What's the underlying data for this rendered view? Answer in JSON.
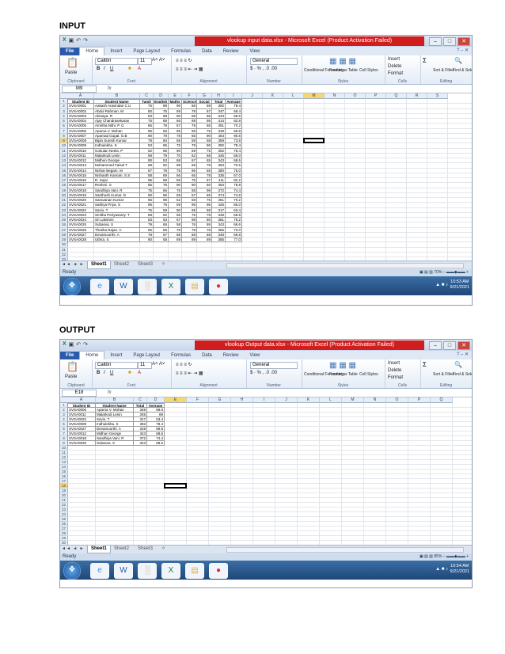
{
  "input_section": {
    "heading": "INPUT",
    "window_title": "vlookup input data.xlsx - Microsoft Excel (Product Activation Failed)",
    "name_box": "M9",
    "formula_fx": "fx",
    "columns": [
      "A",
      "B",
      "C",
      "D",
      "E",
      "F",
      "G",
      "H",
      "I",
      "J",
      "K",
      "L",
      "M",
      "N",
      "O",
      "P",
      "Q",
      "R",
      "S"
    ],
    "table_headers": [
      "Student ID",
      "Student Name",
      "Tamil",
      "English",
      "Maths",
      "Science",
      "Social",
      "Total",
      "Average"
    ],
    "rows": [
      [
        "SVSA0001",
        "Aakash Aravindan C.U",
        "76",
        "89",
        "90",
        "58",
        "69",
        "392",
        "78.4"
      ],
      [
        "SVSA0002",
        "Abdul Rahman. M",
        "80",
        "75",
        "59",
        "78",
        "67",
        "347",
        "69.4"
      ],
      [
        "SVSA0003",
        "Abinaya. R",
        "83",
        "68",
        "60",
        "68",
        "56",
        "343",
        "68.6"
      ],
      [
        "SVSA0004",
        "Ajay Chandrasekaran",
        "75",
        "89",
        "66",
        "89",
        "95",
        "414",
        "82.8"
      ],
      [
        "SVSA0005",
        "Amritha Nithi. P. G",
        "66",
        "79",
        "67",
        "75",
        "65",
        "351",
        "70.2"
      ],
      [
        "SVSA0006",
        "Aparna V. Mohan",
        "85",
        "65",
        "56",
        "69",
        "75",
        "349",
        "69.8"
      ],
      [
        "SVSA0007",
        "Aparnad Gopal. G.B",
        "90",
        "79",
        "78",
        "65",
        "90",
        "454",
        "90.8"
      ],
      [
        "SVSA0008",
        "Bipin Suresh Kumar",
        "78",
        "60",
        "65",
        "59",
        "58",
        "359",
        "73.8"
      ],
      [
        "SVSA0009",
        "Indhulekha. S",
        "53",
        "65",
        "75",
        "79",
        "90",
        "392",
        "78.4"
      ],
      [
        "SVSA0010",
        "Gokulan Neela. P",
        "62",
        "96",
        "90",
        "59",
        "75",
        "392",
        "78.4"
      ],
      [
        "SVSA0011",
        "Malarkodi Lenin",
        "59",
        "79",
        "70",
        "62",
        "68",
        "345",
        "69.0"
      ],
      [
        "SVSA0012",
        "Midhun George",
        "90",
        "53",
        "68",
        "67",
        "65",
        "343",
        "68.6"
      ],
      [
        "SVSA0013",
        "Mohammed Faisal T",
        "68",
        "82",
        "89",
        "58",
        "78",
        "353",
        "70.6"
      ],
      [
        "SVSA0014",
        "Nishar Begam. M",
        "67",
        "78",
        "75",
        "95",
        "65",
        "380",
        "76.0"
      ],
      [
        "SVSA0015",
        "Nishanth Kannan. S.S",
        "58",
        "69",
        "66",
        "65",
        "78",
        "335",
        "67.0"
      ],
      [
        "SVSA0016",
        "R. Sujai",
        "95",
        "89",
        "85",
        "75",
        "67",
        "411",
        "82.2"
      ],
      [
        "SVSA0017",
        "Reshmi. S",
        "65",
        "75",
        "90",
        "90",
        "50",
        "394",
        "78.8"
      ],
      [
        "SVSA0018",
        "Sandhiya Vani. R",
        "75",
        "66",
        "76",
        "58",
        "96",
        "372",
        "74.4"
      ],
      [
        "SVSA0019",
        "Santhosh Kumar. D",
        "90",
        "85",
        "59",
        "67",
        "65",
        "374",
        "74.8"
      ],
      [
        "SVSA0020",
        "Saravanan Kumar",
        "56",
        "98",
        "62",
        "58",
        "75",
        "351",
        "70.2"
      ],
      [
        "SVSA0021",
        "Sathiya Priya. S",
        "95",
        "78",
        "59",
        "95",
        "96",
        "425",
        "85.0"
      ],
      [
        "SVSA0022",
        "Savio. T",
        "75",
        "59",
        "90",
        "65",
        "58",
        "317",
        "63.4"
      ],
      [
        "SVSA0023",
        "Smitha Periyasamy. T",
        "68",
        "62",
        "66",
        "75",
        "78",
        "349",
        "69.8"
      ],
      [
        "SVSA0024",
        "Sri Lakshmi",
        "83",
        "53",
        "67",
        "98",
        "60",
        "381",
        "76.2"
      ],
      [
        "SVSA0025",
        "Subasva. S",
        "79",
        "65",
        "58",
        "76",
        "65",
        "343",
        "68.6"
      ],
      [
        "SVSA0026",
        "Tharika Rajan. C",
        "65",
        "66",
        "78",
        "78",
        "78",
        "365",
        "73.0"
      ],
      [
        "SVSA0027",
        "Devamoorthi. A",
        "78",
        "67",
        "68",
        "68",
        "68",
        "349",
        "69.8"
      ],
      [
        "SVSA0028",
        "Uthira. S",
        "80",
        "58",
        "89",
        "89",
        "89",
        "385",
        "77.0"
      ]
    ],
    "sheet_tabs": [
      "Sheet1",
      "Sheet2",
      "Sheet3"
    ],
    "status": "Ready",
    "zoom": "70%",
    "clock_time": "10:53 AM",
    "clock_date": "9/21/2021"
  },
  "output_section": {
    "heading": "OUTPUT",
    "window_title": "vlookup Output data.xlsx - Microsoft Excel (Product Activation Failed)",
    "name_box": "E18",
    "formula_fx": "fx",
    "columns": [
      "A",
      "B",
      "C",
      "D",
      "E",
      "F",
      "G",
      "H",
      "I",
      "J",
      "K",
      "L",
      "M",
      "N",
      "O",
      "P",
      "Q"
    ],
    "table_headers": [
      "Student ID",
      "Student Name",
      "Total",
      "Average"
    ],
    "rows": [
      [
        "SVSA0006",
        "Aparna V. Mohan",
        "349",
        "69.8"
      ],
      [
        "SVSA0011",
        "Malarkodi Lenin",
        "345",
        "69"
      ],
      [
        "SVSA0022",
        "Savio. T",
        "317",
        "63.4"
      ],
      [
        "SVSA0009",
        "Indhulekha. S",
        "392",
        "78.4"
      ],
      [
        "SVSA0027",
        "Devamoorthi. A",
        "349",
        "69.8"
      ],
      [
        "SVSA0012",
        "Midhun George",
        "343",
        "68.6"
      ],
      [
        "SVSA0018",
        "Sandhiya Vani. R",
        "372",
        "74.4"
      ],
      [
        "SVSA0025",
        "Subasva. S",
        "343",
        "68.6"
      ]
    ],
    "sheet_tabs": [
      "Sheet1",
      "Sheet2",
      "Sheet3"
    ],
    "status": "Ready",
    "zoom": "85%",
    "clock_time": "10:54 AM",
    "clock_date": "9/21/2021"
  },
  "ribbon": {
    "tabs": [
      "File",
      "Home",
      "Insert",
      "Page Layout",
      "Formulas",
      "Data",
      "Review",
      "View"
    ],
    "font_name": "Calibri",
    "font_size": "11",
    "number_format": "General",
    "groups": [
      "Clipboard",
      "Font",
      "Alignment",
      "Number",
      "Styles",
      "Cells",
      "Editing"
    ],
    "paste": "Paste",
    "conditional_formatting": "Conditional Formatting",
    "format_as_table": "Format as Table",
    "cell_styles": "Cell Styles",
    "insert": "Insert",
    "delete": "Delete",
    "format": "Format",
    "sort_filter": "Sort & Filter",
    "find_select": "Find & Select"
  },
  "colors": {
    "title_red": "#d01e1e",
    "file_tab": "#2a5aa8",
    "taskbar": "#1f4778",
    "row_highlight": "#f8e99a"
  },
  "icons": [
    "excel-icon",
    "save-icon",
    "undo-icon",
    "redo-icon",
    "help-icon",
    "paste-icon",
    "bold-icon",
    "italic-icon",
    "underline-icon",
    "sum-icon",
    "sort-icon",
    "find-icon",
    "start-icon",
    "ie-icon",
    "word-icon",
    "chart-icon",
    "excel-taskbar-icon",
    "folder-icon",
    "chrome-icon"
  ]
}
